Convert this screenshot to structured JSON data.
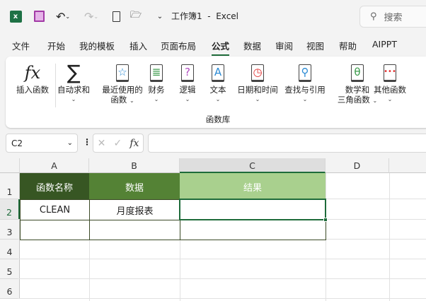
{
  "titlebar": {
    "title": "工作簿1  -  Excel",
    "search_placeholder": "搜索"
  },
  "tabs": [
    "文件",
    "开始",
    "我的模板",
    "插入",
    "页面布局",
    "公式",
    "数据",
    "审阅",
    "视图",
    "帮助",
    "AIPPT"
  ],
  "active_tab": "公式",
  "ribbon": {
    "insert_function": "插入函数",
    "buttons": [
      {
        "l1": "自动求和",
        "l2": ""
      },
      {
        "l1": "最近使用的",
        "l2": "函数"
      },
      {
        "l1": "财务",
        "l2": ""
      },
      {
        "l1": "逻辑",
        "l2": ""
      },
      {
        "l1": "文本",
        "l2": ""
      },
      {
        "l1": "日期和时间",
        "l2": ""
      },
      {
        "l1": "查找与引用",
        "l2": ""
      },
      {
        "l1": "数学和",
        "l2": "三角函数"
      },
      {
        "l1": "其他函数",
        "l2": ""
      }
    ],
    "group_label": "函数库"
  },
  "formula_bar": {
    "name_box": "C2",
    "fx": "fx",
    "value": ""
  },
  "sheet": {
    "columns": [
      "A",
      "B",
      "C",
      "D"
    ],
    "rows": [
      "1",
      "2",
      "3",
      "4",
      "5",
      "6"
    ],
    "header": [
      "函数名称",
      "数据",
      "结果"
    ],
    "header_colors": [
      "#375623",
      "#548235",
      "#a9d08e"
    ],
    "row2": [
      "CLEAN",
      "月度报表",
      ""
    ]
  }
}
